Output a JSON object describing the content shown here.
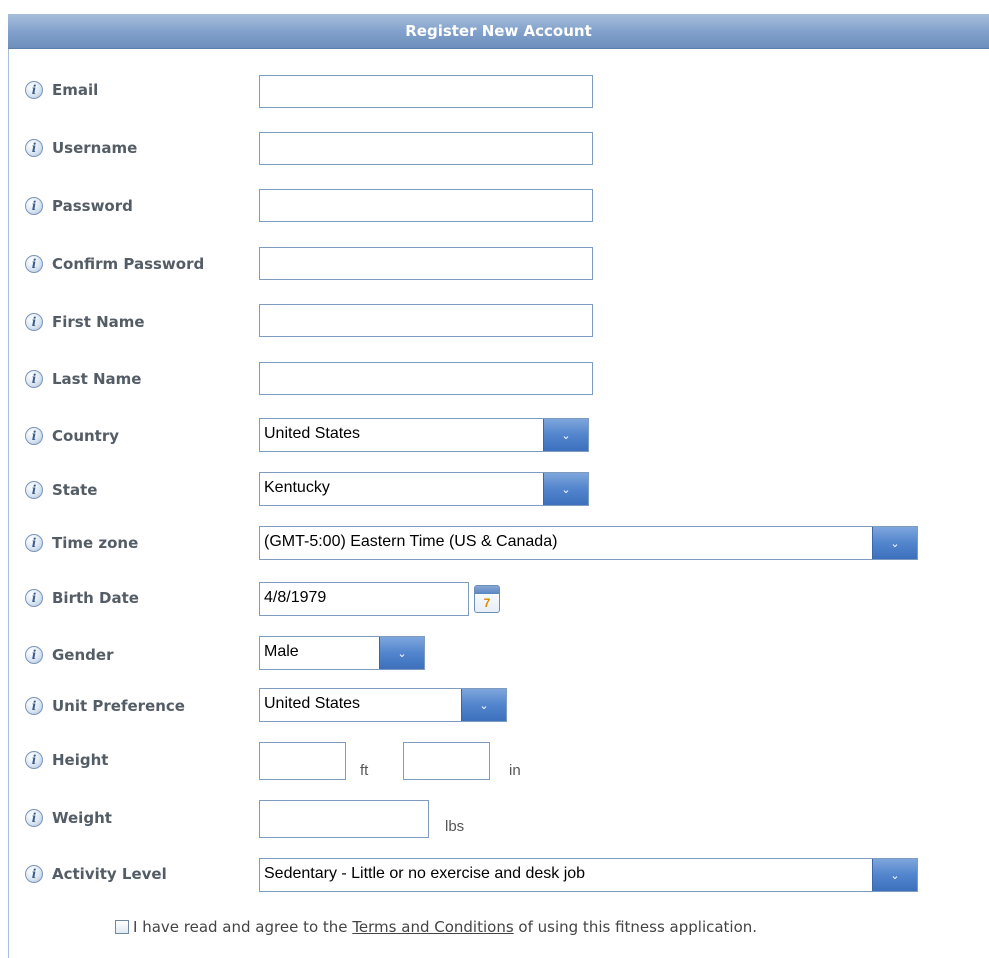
{
  "header": {
    "title": "Register New Account"
  },
  "info_icon_glyph": "i",
  "fields": {
    "email": {
      "label": "Email",
      "value": ""
    },
    "username": {
      "label": "Username",
      "value": ""
    },
    "password": {
      "label": "Password",
      "value": ""
    },
    "confirm_password": {
      "label": "Confirm Password",
      "value": ""
    },
    "first_name": {
      "label": "First Name",
      "value": ""
    },
    "last_name": {
      "label": "Last Name",
      "value": ""
    },
    "country": {
      "label": "Country",
      "value": "United States"
    },
    "state": {
      "label": "State",
      "value": "Kentucky"
    },
    "time_zone": {
      "label": "Time zone",
      "value": "(GMT-5:00) Eastern Time (US & Canada)"
    },
    "birth_date": {
      "label": "Birth Date",
      "value": "4/8/1979",
      "calendar_day": "7"
    },
    "gender": {
      "label": "Gender",
      "value": "Male"
    },
    "unit_preference": {
      "label": "Unit Preference",
      "value": "United States"
    },
    "height": {
      "label": "Height",
      "ft_value": "",
      "ft_unit": "ft",
      "in_value": "",
      "in_unit": "in"
    },
    "weight": {
      "label": "Weight",
      "value": "",
      "unit": "lbs"
    },
    "activity_level": {
      "label": "Activity Level",
      "value": "Sedentary - Little or no exercise and desk job"
    }
  },
  "agreement": {
    "prefix": "I have read and agree to the",
    "link_text": "Terms and Conditions",
    "suffix": "of using this fitness application."
  },
  "dropdown_arrow_glyph": "⌄",
  "colors": {
    "header_bg": "#809fca",
    "dropdown_button": "#5285cd",
    "label": "#545d66"
  }
}
